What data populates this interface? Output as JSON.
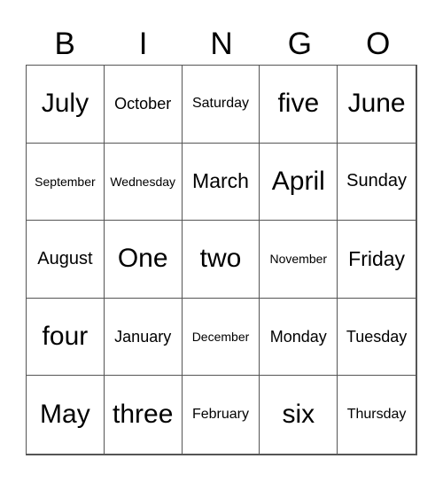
{
  "title_letters": [
    "B",
    "I",
    "N",
    "G",
    "O"
  ],
  "rows": [
    [
      "July",
      "October",
      "Saturday",
      "five",
      "June"
    ],
    [
      "September",
      "Wednesday",
      "March",
      "April",
      "Sunday"
    ],
    [
      "August",
      "One",
      "two",
      "November",
      "Friday"
    ],
    [
      "four",
      "January",
      "December",
      "Monday",
      "Tuesday"
    ],
    [
      "May",
      "three",
      "February",
      "six",
      "Thursday"
    ]
  ]
}
